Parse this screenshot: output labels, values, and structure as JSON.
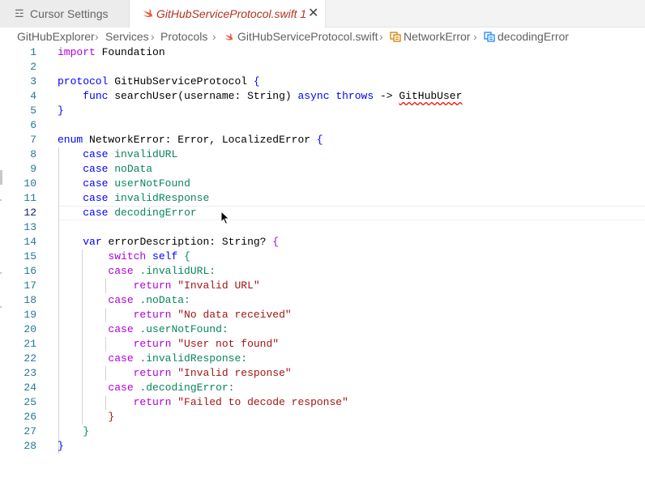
{
  "tabs": [
    {
      "label": "Cursor Settings",
      "icon": "settings-sliders-icon",
      "active": false
    },
    {
      "label": "GitHubServiceProtocol.swift",
      "problems": "1",
      "close": "✕",
      "icon": "swift-icon",
      "active": true
    }
  ],
  "breadcrumb": {
    "items": [
      "GitHubExplorer",
      "Services",
      "Protocols",
      "GitHubServiceProtocol.swift",
      "NetworkError",
      "decodingError"
    ],
    "separator": "›"
  },
  "editor": {
    "current_line": 12,
    "lines": [
      {
        "n": "1"
      },
      {
        "n": "2"
      },
      {
        "n": "3"
      },
      {
        "n": "4"
      },
      {
        "n": "5"
      },
      {
        "n": "6"
      },
      {
        "n": "7"
      },
      {
        "n": "8"
      },
      {
        "n": "9"
      },
      {
        "n": "10"
      },
      {
        "n": "11"
      },
      {
        "n": "12"
      },
      {
        "n": "13"
      },
      {
        "n": "14"
      },
      {
        "n": "15"
      },
      {
        "n": "16"
      },
      {
        "n": "17"
      },
      {
        "n": "18"
      },
      {
        "n": "19"
      },
      {
        "n": "20"
      },
      {
        "n": "21"
      },
      {
        "n": "22"
      },
      {
        "n": "23"
      },
      {
        "n": "24"
      },
      {
        "n": "25"
      },
      {
        "n": "26"
      },
      {
        "n": "27"
      },
      {
        "n": "28"
      }
    ],
    "code": {
      "import": "import",
      "foundation": "Foundation",
      "protocol": "protocol",
      "protocol_name": "GitHubServiceProtocol",
      "brace_open": "{",
      "func": "func",
      "func_sig": "searchUser(username: String)",
      "async": "async",
      "throws": "throws",
      "arrow": "->",
      "return_type": "GitHubUser",
      "brace_close": "}",
      "enum": "enum",
      "enum_decl": "NetworkError: Error, LocalizedError",
      "case": "case",
      "cases": [
        "invalidURL",
        "noData",
        "userNotFound",
        "invalidResponse",
        "decodingError"
      ],
      "var": "var",
      "var_decl": "errorDescription: String?",
      "switch": "switch",
      "self": "self",
      "dot_cases": [
        ".invalidURL:",
        ".noData:",
        ".userNotFound:",
        ".invalidResponse:",
        ".decodingError:"
      ],
      "return": "return",
      "messages": [
        "\"Invalid URL\"",
        "\"No data received\"",
        "\"User not found\"",
        "\"Invalid response\"",
        "\"Failed to decode response\""
      ]
    }
  },
  "colors": {
    "keyword": "#0000ff",
    "control": "#af00db",
    "string": "#a31515",
    "member": "#098658",
    "line_number": "#237893",
    "tab_modified": "#b2321f"
  }
}
